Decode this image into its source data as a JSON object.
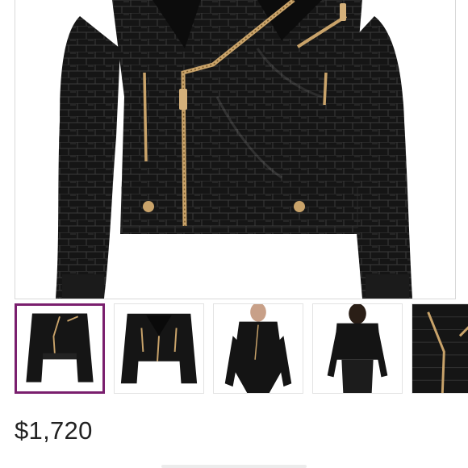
{
  "product": {
    "main_image_icon": "leather-moto-jacket-image",
    "price": "$1,720",
    "selected_thumbnail_index": 0
  },
  "thumbnails": [
    {
      "icon": "jacket-front-flat-image"
    },
    {
      "icon": "jacket-front-open-image"
    },
    {
      "icon": "model-front-image"
    },
    {
      "icon": "model-back-image"
    },
    {
      "icon": "jacket-detail-image"
    }
  ],
  "colors": {
    "selected_border": "#7a1f6e",
    "jacket": "#161616",
    "zipper": "#c9a36a"
  }
}
